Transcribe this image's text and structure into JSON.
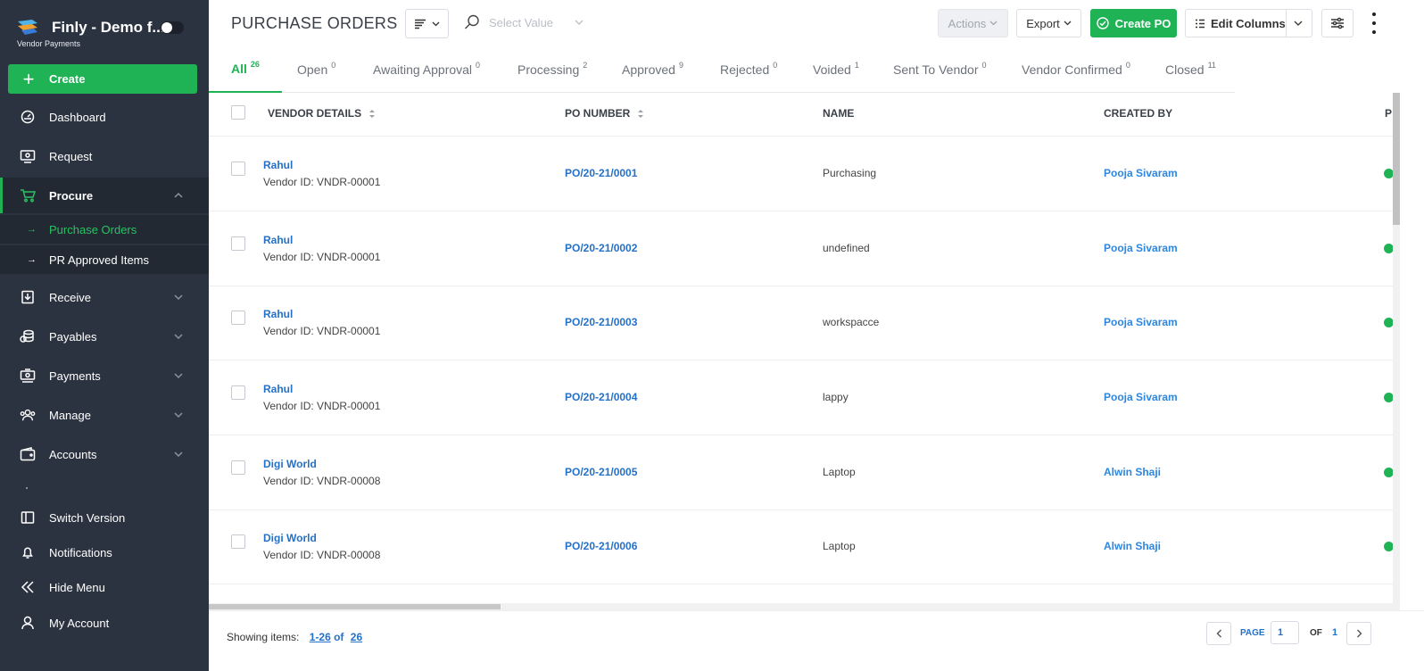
{
  "brand": {
    "title": "Finly - Demo f...",
    "subtitle": "Vendor Payments"
  },
  "sidebar": {
    "create_label": "Create",
    "items": [
      {
        "label": "Dashboard",
        "icon": "dashboard-icon"
      },
      {
        "label": "Request",
        "icon": "request-icon"
      },
      {
        "label": "Procure",
        "icon": "cart-icon"
      },
      {
        "label": "Receive",
        "icon": "receive-icon"
      },
      {
        "label": "Payables",
        "icon": "coins-icon"
      },
      {
        "label": "Payments",
        "icon": "payments-icon"
      },
      {
        "label": "Manage",
        "icon": "users-icon"
      },
      {
        "label": "Accounts",
        "icon": "wallet-icon"
      }
    ],
    "sub_items": [
      {
        "label": "Purchase Orders"
      },
      {
        "label": "PR Approved Items"
      }
    ],
    "bottom_items": [
      {
        "label": "Switch Version",
        "icon": "switch-icon"
      },
      {
        "label": "Notifications",
        "icon": "bell-icon"
      },
      {
        "label": "Hide Menu",
        "icon": "double-chevron-left-icon"
      },
      {
        "label": "My Account",
        "icon": "user-icon"
      }
    ]
  },
  "header": {
    "title": "PURCHASE ORDERS",
    "search_placeholder": "Select Value",
    "actions_label": "Actions",
    "export_label": "Export",
    "create_po_label": "Create PO",
    "edit_columns_label": "Edit Columns"
  },
  "tabs": [
    {
      "label": "All",
      "count": "26"
    },
    {
      "label": "Open",
      "count": "0"
    },
    {
      "label": "Awaiting Approval",
      "count": "0"
    },
    {
      "label": "Processing",
      "count": "2"
    },
    {
      "label": "Approved",
      "count": "9"
    },
    {
      "label": "Rejected",
      "count": "0"
    },
    {
      "label": "Voided",
      "count": "1"
    },
    {
      "label": "Sent To Vendor",
      "count": "0"
    },
    {
      "label": "Vendor Confirmed",
      "count": "0"
    },
    {
      "label": "Closed",
      "count": "11"
    }
  ],
  "table": {
    "columns": [
      "VENDOR DETAILS",
      "PO NUMBER",
      "NAME",
      "CREATED BY",
      "P"
    ],
    "rows": [
      {
        "vendor": "Rahul",
        "vendor_id": "Vendor ID: VNDR-00001",
        "po_number": "PO/20-21/0001",
        "name": "Purchasing",
        "created_by": "Pooja Sivaram"
      },
      {
        "vendor": "Rahul",
        "vendor_id": "Vendor ID: VNDR-00001",
        "po_number": "PO/20-21/0002",
        "name": "undefined",
        "created_by": "Pooja Sivaram"
      },
      {
        "vendor": "Rahul",
        "vendor_id": "Vendor ID: VNDR-00001",
        "po_number": "PO/20-21/0003",
        "name": "workspacce",
        "created_by": "Pooja Sivaram"
      },
      {
        "vendor": "Rahul",
        "vendor_id": "Vendor ID: VNDR-00001",
        "po_number": "PO/20-21/0004",
        "name": "lappy",
        "created_by": "Pooja Sivaram"
      },
      {
        "vendor": "Digi World",
        "vendor_id": "Vendor ID: VNDR-00008",
        "po_number": "PO/20-21/0005",
        "name": "Laptop",
        "created_by": "Alwin Shaji"
      },
      {
        "vendor": "Digi World",
        "vendor_id": "Vendor ID: VNDR-00008",
        "po_number": "PO/20-21/0006",
        "name": "Laptop",
        "created_by": "Alwin Shaji"
      }
    ]
  },
  "footer": {
    "showing_label": "Showing items:",
    "range": "1-26",
    "of_label": "of",
    "total": "26",
    "page_label": "PAGE",
    "page_value": "1",
    "page_of_label": "OF",
    "page_total": "1"
  },
  "colors": {
    "accent": "#1fb356",
    "sidebar_bg": "#2c3340",
    "link": "#2471c8"
  }
}
